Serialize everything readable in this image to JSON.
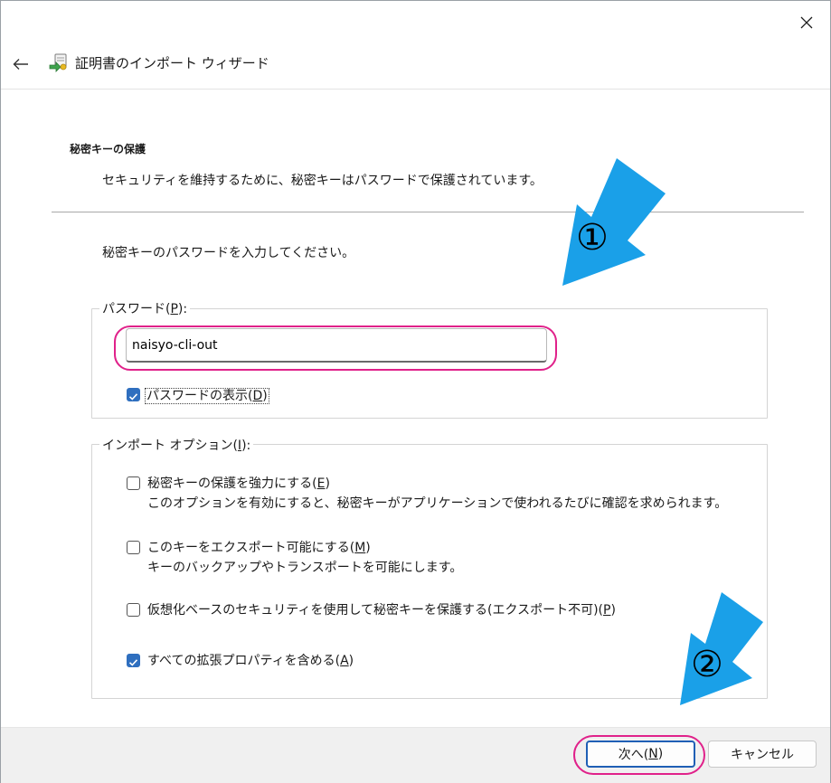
{
  "window": {
    "title": "証明書のインポート ウィザード"
  },
  "header": {
    "section_title": "秘密キーの保護",
    "section_desc": "セキュリティを維持するために、秘密キーはパスワードで保護されています。"
  },
  "prompt": "秘密キーのパスワードを入力してください。",
  "password_group": {
    "legend_prefix": "パスワード(",
    "legend_key": "P",
    "legend_suffix": "):",
    "value": "naisyo-cli-out",
    "show_password": {
      "checked": true,
      "label_prefix": "パスワードの表示(",
      "label_key": "D",
      "label_suffix": ")"
    }
  },
  "import_options": {
    "legend_prefix": "インポート オプション(",
    "legend_key": "I",
    "legend_suffix": "):",
    "options": [
      {
        "checked": false,
        "label_prefix": "秘密キーの保護を強力にする(",
        "label_key": "E",
        "label_suffix": ")",
        "desc": "このオプションを有効にすると、秘密キーがアプリケーションで使われるたびに確認を求められます。"
      },
      {
        "checked": false,
        "label_prefix": "このキーをエクスポート可能にする(",
        "label_key": "M",
        "label_suffix": ")",
        "desc": "キーのバックアップやトランスポートを可能にします。"
      },
      {
        "checked": false,
        "label_prefix": "仮想化ベースのセキュリティを使用して秘密キーを保護する(エクスポート不可)(",
        "label_key": "P",
        "label_suffix": ")",
        "desc": ""
      },
      {
        "checked": true,
        "label_prefix": "すべての拡張プロパティを含める(",
        "label_key": "A",
        "label_suffix": ")",
        "desc": ""
      }
    ]
  },
  "footer": {
    "next_prefix": "次へ(",
    "next_key": "N",
    "next_suffix": ")",
    "cancel_label": "キャンセル"
  },
  "annotations": {
    "step1": "①",
    "step2": "②",
    "arrow_color": "#1aa0e8",
    "highlight_color": "#e0218a"
  },
  "colors": {
    "checkbox_checked": "#2f6fbf",
    "primary_button_border": "#1f5fb5"
  }
}
